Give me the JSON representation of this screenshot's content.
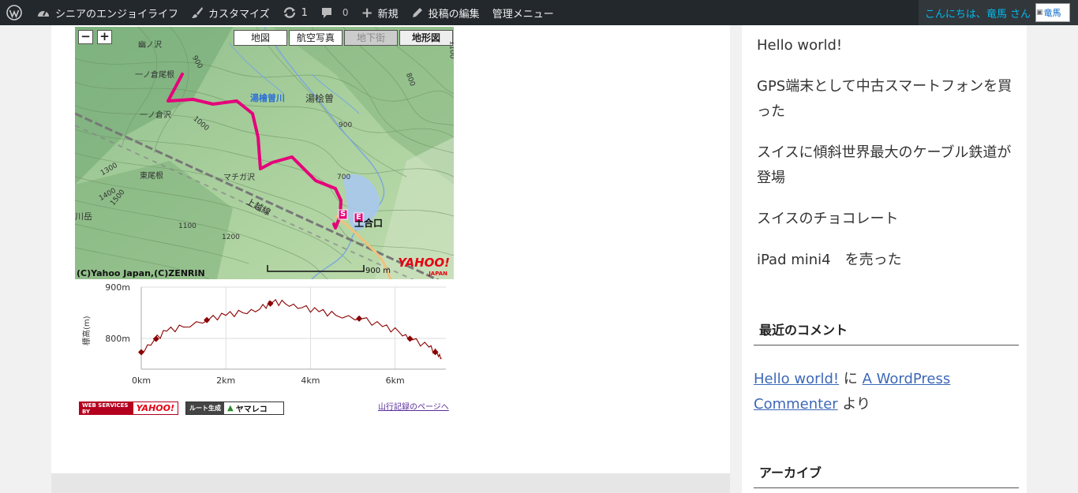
{
  "adminbar": {
    "site_name": "シニアのエンジョイライフ",
    "customize": "カスタマイズ",
    "updates_count": "1",
    "comments_count": "0",
    "new": "新規",
    "edit_post": "投稿の編集",
    "admin_menu": "管理メニュー",
    "greeting": "こんにちは、竜馬 さん",
    "avatar_alt": "竜馬"
  },
  "map": {
    "zoom_out": "−",
    "zoom_in": "+",
    "tabs": [
      {
        "label": "地図",
        "state": "normal"
      },
      {
        "label": "航空写真",
        "state": "normal"
      },
      {
        "label": "地下街",
        "state": "disabled"
      },
      {
        "label": "地形図",
        "state": "active"
      }
    ],
    "labels": {
      "ichinokurazawa": "一ノ倉沢",
      "ichinokuraone": "一ノ倉尾根",
      "yubisogawa": "湯檜曽川",
      "yubiso": "湯桧曽",
      "higashione": "東尾根",
      "machigasawa": "マチガ沢",
      "joetsu": "上越線",
      "dogoguchi": "土合口",
      "ryudake": "川岳",
      "top_sawa": "幽ノ沢",
      "start": "S",
      "end": "E"
    },
    "contours": [
      "900",
      "1000",
      "1100",
      "1200",
      "1300",
      "1400",
      "1500",
      "900",
      "800",
      "700",
      "1100",
      "1000"
    ],
    "copyright": "(C)Yahoo Japan,(C)ZENRIN",
    "scale": "900 m",
    "logo": "YAHOO!",
    "logo_sub": "JAPAN"
  },
  "elevation": {
    "ylabel": "標高(m)",
    "yticks": [
      "900m",
      "800m"
    ],
    "xticks": [
      "0km",
      "2km",
      "4km",
      "6km"
    ]
  },
  "chart_data": {
    "type": "line",
    "title": "",
    "xlabel": "",
    "ylabel": "標高(m)",
    "x": [
      0,
      0.3,
      0.6,
      1.0,
      1.6,
      2.0,
      2.4,
      2.8,
      3.1,
      3.4,
      3.8,
      4.2,
      4.6,
      5.2,
      5.7,
      6.1,
      6.4,
      6.8,
      7.0,
      7.1
    ],
    "values": [
      773,
      796,
      814,
      822,
      837,
      845,
      850,
      857,
      870,
      868,
      860,
      852,
      845,
      838,
      823,
      812,
      797,
      783,
      770,
      762
    ],
    "markers_x": [
      0,
      0.35,
      1.55,
      3.05,
      5.15,
      6.35,
      6.95
    ],
    "xlim": [
      0,
      7.2
    ],
    "ylim": [
      740,
      900
    ]
  },
  "badges": {
    "yahoo_left": "WEB SERVICES BY",
    "yahoo_right": "YAHOO!",
    "yamareco_left": "ルート生成",
    "yamareco_right": "ヤマレコ"
  },
  "log_link": "山行記録のページへ",
  "sidebar": {
    "recent_posts": [
      "Hello world!",
      "GPS端末として中古スマートフォンを買った",
      "スイスに傾斜世界最大のケーブル鉄道が登場",
      "スイスのチョコレート",
      "iPad mini4　を売った"
    ],
    "recent_comments_title": "最近のコメント",
    "comment": {
      "post": "Hello world!",
      "connector": " に ",
      "author": "A WordPress Commenter",
      "suffix": " より"
    },
    "archive_title": "アーカイブ"
  },
  "colors": {
    "adminbar": "#23282d",
    "accent_link": "#00b9eb",
    "route": "#e5007a",
    "elev_line": "#8b0000"
  }
}
